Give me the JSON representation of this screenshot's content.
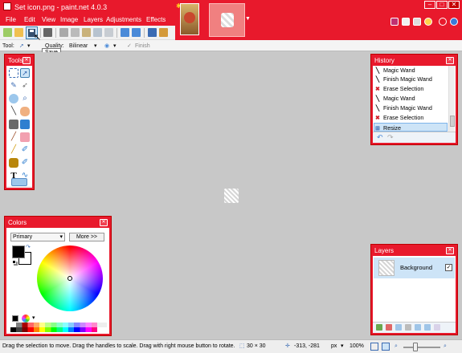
{
  "window": {
    "title": "Set icon.png - paint.net 4.0.3",
    "minimize": "–",
    "maximize": "□",
    "close": "✕"
  },
  "menu": [
    "File",
    "Edit",
    "View",
    "Image",
    "Layers",
    "Adjustments",
    "Effects"
  ],
  "thumbnails": {
    "arrow": "▼",
    "modified_marker": "✱"
  },
  "toolbar": {
    "save_tooltip": "Save",
    "tool_label": "Tool:",
    "quality_label": "Quality:",
    "quality_value": "Bilinear",
    "dropdown_arrow": "▾",
    "finish_label": "Finish"
  },
  "tools_panel": {
    "title": "Tools",
    "close": "✕"
  },
  "history_panel": {
    "title": "History",
    "close": "✕",
    "items": [
      {
        "icon": "magic-wand-icon",
        "glyph": "╲",
        "label": "Magic Wand"
      },
      {
        "icon": "magic-wand-icon",
        "glyph": "╲",
        "label": "Finish Magic Wand"
      },
      {
        "icon": "erase-selection-icon",
        "glyph": "✖",
        "label": "Erase Selection"
      },
      {
        "icon": "magic-wand-icon",
        "glyph": "╲",
        "label": "Magic Wand"
      },
      {
        "icon": "magic-wand-icon",
        "glyph": "╲",
        "label": "Finish Magic Wand"
      },
      {
        "icon": "erase-selection-icon",
        "glyph": "✖",
        "label": "Erase Selection"
      },
      {
        "icon": "resize-icon",
        "glyph": "⊞",
        "label": "Resize"
      }
    ],
    "undo": "↶",
    "redo": "↷"
  },
  "colors_panel": {
    "title": "Colors",
    "close": "✕",
    "mode": "Primary",
    "more_button": "More >>",
    "primary_color": "#000000",
    "secondary_color": "#ffffff"
  },
  "layers_panel": {
    "title": "Layers",
    "close": "✕",
    "layers": [
      {
        "name": "Background",
        "visible": true
      }
    ],
    "checkmark": "✓"
  },
  "status": {
    "hint": "Drag the selection to move. Drag the handles to scale. Drag with right mouse button to rotate.",
    "selection_size": "30 × 30",
    "cursor_position": "-313, -281",
    "units": "px",
    "zoom": "100%"
  },
  "colors": {
    "accent": "#e8192c",
    "selection": "#cde4f7"
  }
}
